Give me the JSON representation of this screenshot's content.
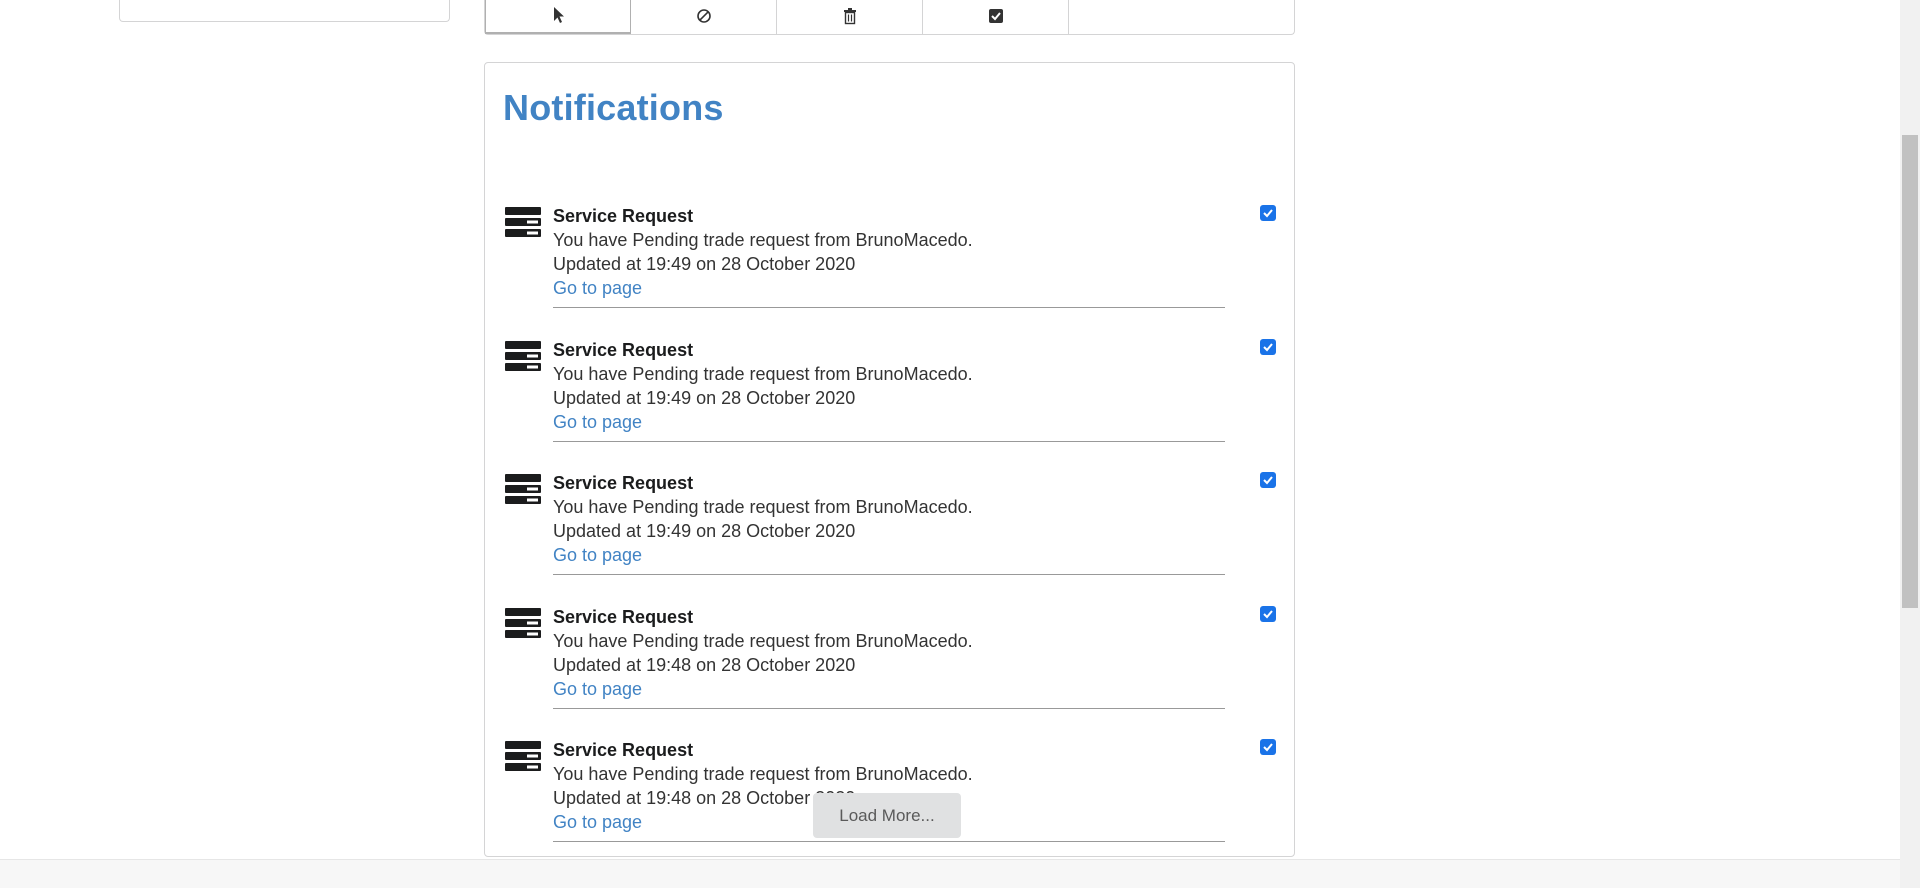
{
  "toolbar": {
    "buttons": [
      {
        "icon": "pointer-icon"
      },
      {
        "icon": "ban-icon"
      },
      {
        "icon": "trash-icon"
      },
      {
        "icon": "check-square-icon"
      }
    ]
  },
  "notifications": {
    "title": "Notifications",
    "go_to_page_label": "Go to page",
    "items": [
      {
        "title": "Service Request",
        "message": "You have Pending trade request from BrunoMacedo.",
        "updated": "Updated at 19:49 on 28 October 2020",
        "link": "Go to page",
        "checked": true
      },
      {
        "title": "Service Request",
        "message": "You have Pending trade request from BrunoMacedo.",
        "updated": "Updated at 19:49 on 28 October 2020",
        "link": "Go to page",
        "checked": true
      },
      {
        "title": "Service Request",
        "message": "You have Pending trade request from BrunoMacedo.",
        "updated": "Updated at 19:49 on 28 October 2020",
        "link": "Go to page",
        "checked": true
      },
      {
        "title": "Service Request",
        "message": "You have Pending trade request from BrunoMacedo.",
        "updated": "Updated at 19:48 on 28 October 2020",
        "link": "Go to page",
        "checked": true
      },
      {
        "title": "Service Request",
        "message": "You have Pending trade request from BrunoMacedo.",
        "updated": "Updated at 19:48 on 28 October 2020",
        "link": "Go to page",
        "checked": true
      }
    ],
    "load_more_label": "Load More..."
  },
  "colors": {
    "accent": "#4183c4",
    "checkbox": "#1a73e8"
  }
}
